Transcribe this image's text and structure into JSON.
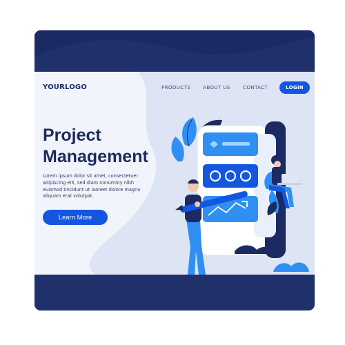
{
  "header": {
    "logo": "YOURLOGO",
    "nav": [
      "PRODUCTS",
      "ABOUT US",
      "CONTACT"
    ],
    "login_label": "LOGIN"
  },
  "hero": {
    "title_line1": "Project",
    "title_line2": "Management",
    "description": "Lorem ipsum dolor sit amet, consectetuer adipiscing elit, sed diam nonummy nibh euismod tincidunt ut laoreet dolore magna aliquam erat volutpat.",
    "cta_label": "Learn More"
  },
  "colors": {
    "navy": "#20306b",
    "accent": "#1356e0",
    "page_bg": "#f1f4fb",
    "light_shape": "#dde4f3",
    "illustration_blue": "#2f8ff2"
  },
  "icons": [
    "leaf-icon",
    "analytics-screen-icon",
    "line-chart-icon",
    "pencil-icon",
    "laptop-icon"
  ]
}
